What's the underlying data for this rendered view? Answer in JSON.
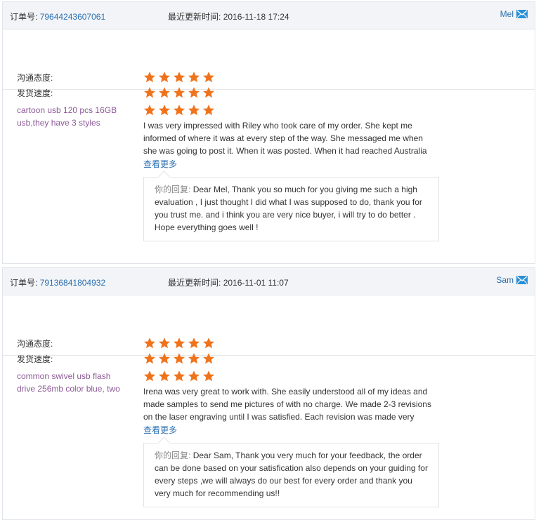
{
  "labels": {
    "order_no": "订单号:",
    "updated": "最近更新时间:",
    "communication": "沟通态度:",
    "shipping": "发货速度:",
    "more": "查看更多",
    "reply_prefix": "你的回复:"
  },
  "orders": [
    {
      "order_number": "79644243607061",
      "updated_time": "2016-11-18 17:24",
      "buyer": "Mel",
      "communication_stars": 5,
      "shipping_stars": 5,
      "product": "cartoon usb 120 pcs 16GB usb,they have 3 styles",
      "review_stars": 5,
      "review_text": "I was very impressed with Riley who took care of my order. She kept me informed of where it was at every step of the way. She messaged me when she was going to post it. When it was posted. When it had reached Australia",
      "reply": "Dear Mel, Thank you so much for you giving me such a high evaluation , I just thought I did what I was supposed to do, thank you for you trust me. and i think you are very nice buyer, i will try to do better . Hope everything goes well !"
    },
    {
      "order_number": "79136841804932",
      "updated_time": "2016-11-01 11:07",
      "buyer": "Sam",
      "communication_stars": 5,
      "shipping_stars": 5,
      "product": "common swivel usb flash drive 256mb color blue, two",
      "review_stars": 5,
      "review_text": "Irena was very great to work with. She easily understood all of my ideas and made samples to send me pictures of with no charge. We made 2-3 revisions on the laser engraving until I was satisfied. Each revision was made very",
      "reply": "Dear Sam, Thank you very much for your feedback, the order can be done based on your satisfication also depends on your guiding for every steps ,we will always do our best for every order and thank you very much for recommending us!!"
    }
  ],
  "colors": {
    "star": "#f0731c",
    "link": "#2a6fb0",
    "product": "#8d5a97",
    "header_bg": "#f2f4f7"
  },
  "icons": {
    "star": "star-icon",
    "mail": "envelope-icon"
  }
}
